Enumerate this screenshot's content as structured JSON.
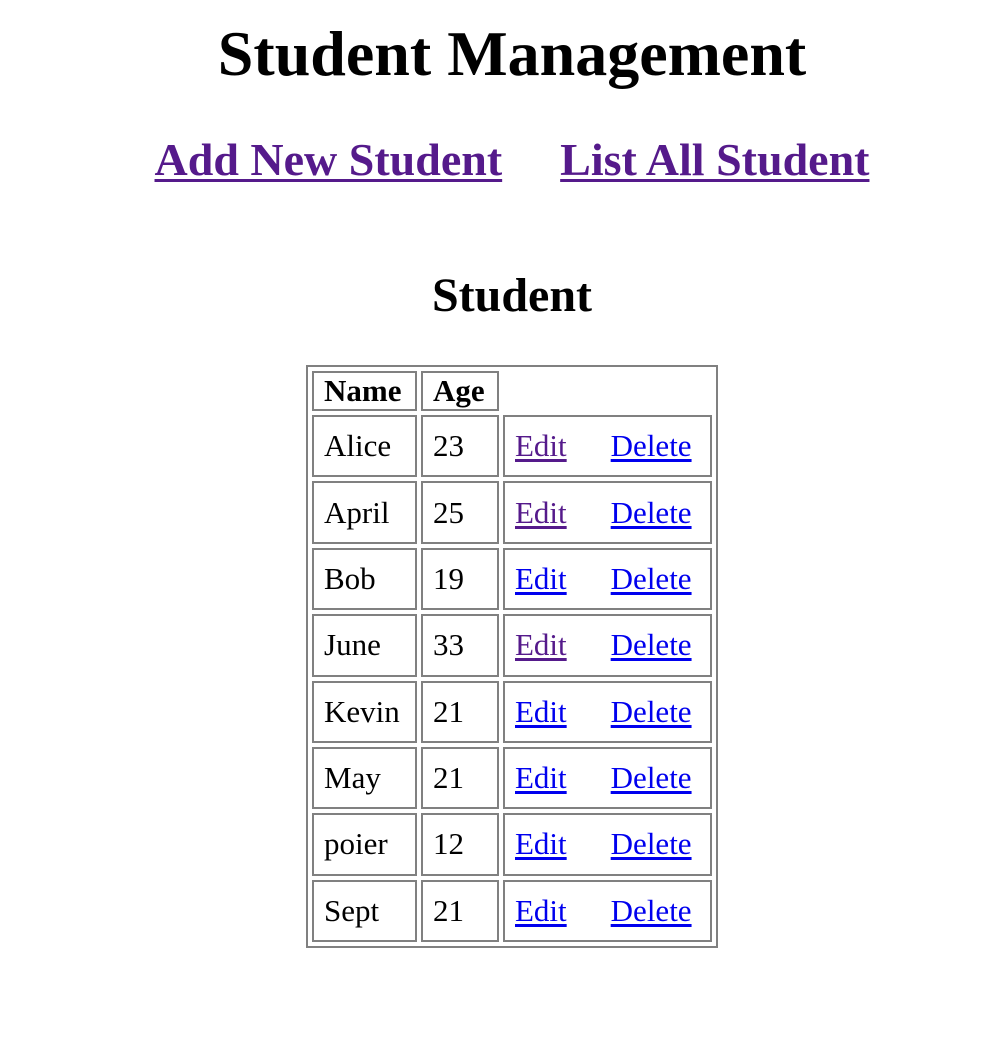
{
  "header": {
    "title": "Student Management"
  },
  "nav": {
    "add_label": "Add New Student",
    "list_label": "List All Student"
  },
  "table": {
    "caption": "Student",
    "columns": [
      "Name",
      "Age"
    ],
    "edit_label": "Edit",
    "delete_label": "Delete",
    "rows": [
      {
        "name": "Alice",
        "age": "23",
        "edit_visited": true
      },
      {
        "name": "April",
        "age": "25",
        "edit_visited": true
      },
      {
        "name": "Bob",
        "age": "19",
        "edit_visited": false
      },
      {
        "name": "June",
        "age": "33",
        "edit_visited": true
      },
      {
        "name": "Kevin",
        "age": "21",
        "edit_visited": false
      },
      {
        "name": "May",
        "age": "21",
        "edit_visited": false
      },
      {
        "name": "poier",
        "age": "12",
        "edit_visited": false
      },
      {
        "name": "Sept",
        "age": "21",
        "edit_visited": false
      }
    ]
  },
  "colors": {
    "visited_link": "#551a8b",
    "unvisited_link": "#0000ee",
    "table_border": "#808080"
  }
}
